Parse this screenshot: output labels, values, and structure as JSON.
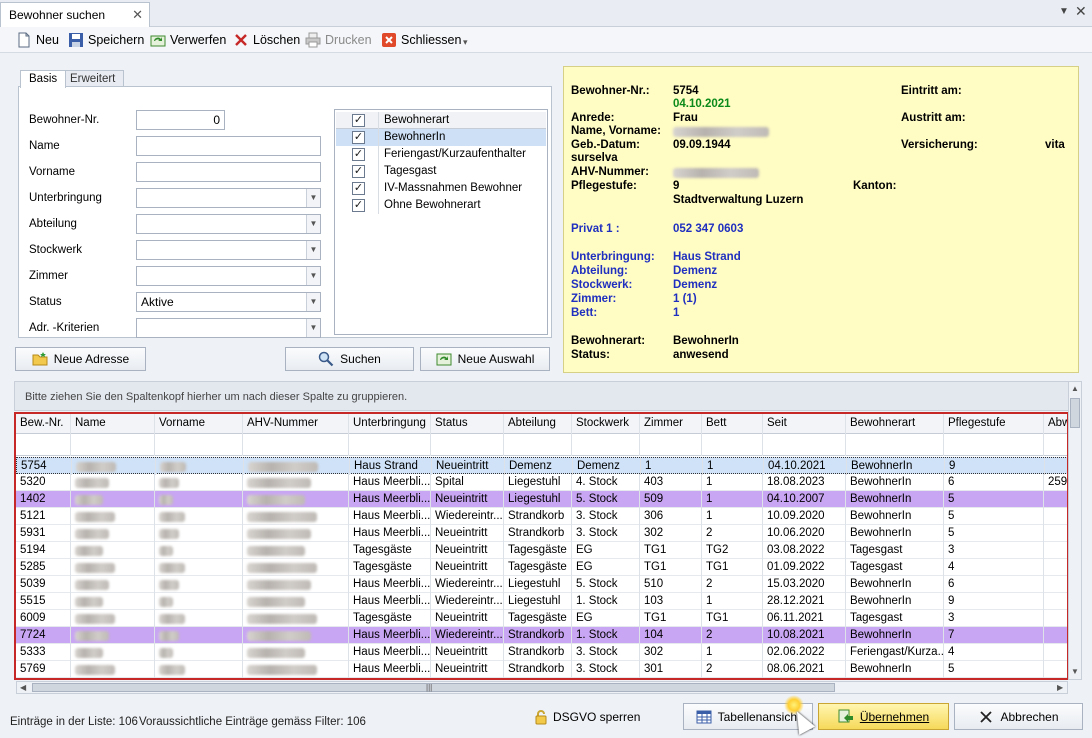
{
  "tab": {
    "title": "Bewohner suchen",
    "close": "✕"
  },
  "window": {
    "menu_arrow": "▼",
    "close": "✕"
  },
  "toolbar": {
    "neu": "Neu",
    "speichern": "Speichern",
    "verwerfen": "Verwerfen",
    "loeschen": "Löschen",
    "drucken": "Drucken",
    "schliessen": "Schliessen",
    "overflow": "▾"
  },
  "search": {
    "tabs": [
      "Basis",
      "Erweitert"
    ],
    "labels": {
      "bewohner_nr": "Bewohner-Nr.",
      "name": "Name",
      "vorname": "Vorname",
      "unterbringung": "Unterbringung",
      "abteilung": "Abteilung",
      "stockwerk": "Stockwerk",
      "zimmer": "Zimmer",
      "status": "Status",
      "adr": "Adr. -Kriterien"
    },
    "values": {
      "bewohner_nr": "0",
      "status": "Aktive"
    },
    "dropdown_arrow": "▼",
    "checklist": {
      "header": "Bewohnerart",
      "items": [
        "BewohnerIn",
        "Feriengast/Kurzaufenthalter",
        "Tagesgast",
        "IV-Massnahmen Bewohner",
        "Ohne Bewohnerart"
      ],
      "check": "✓"
    },
    "buttons": {
      "neue_adresse": "Neue Adresse",
      "suchen": "Suchen",
      "neue_auswahl": "Neue Auswahl"
    }
  },
  "info": {
    "bewohner_nr_label": "Bewohner-Nr.:",
    "bewohner_nr": "5754",
    "date": "04.10.2021",
    "eintritt_label": "Eintritt am:",
    "anrede_label": "Anrede:",
    "anrede": "Frau",
    "austritt_label": "Austritt am:",
    "name_label": "Name, Vorname:",
    "geb_label": "Geb.-Datum:",
    "geb": "09.09.1944",
    "versicherung_label": "Versicherung:",
    "versicherung": "vita",
    "surselva": "surselva",
    "ahv_label": "AHV-Nummer:",
    "pflegestufe_label": "Pflegestufe:",
    "pflegestufe": "9",
    "kanton_label": "Kanton:",
    "verwaltung": "Stadtverwaltung Luzern",
    "privat_label": "Privat 1 :",
    "privat": "052 347 0603",
    "unterbringung_label": "Unterbringung:",
    "unterbringung": "Haus Strand",
    "abteilung_label": "Abteilung:",
    "abteilung": "Demenz",
    "stockwerk_label": "Stockwerk:",
    "stockwerk": "Demenz",
    "zimmer_label": "Zimmer:",
    "zimmer": "1 (1)",
    "bett_label": "Bett:",
    "bett": "1",
    "bewohnerart_label": "Bewohnerart:",
    "bewohnerart": "BewohnerIn",
    "status_label": "Status:",
    "status": "anwesend"
  },
  "grid": {
    "group_hint": "Bitte ziehen Sie den Spaltenkopf hierher um nach dieser Spalte zu gruppieren.",
    "columns": [
      "Bew.-Nr.",
      "Name",
      "Vorname",
      "AHV-Nummer",
      "Unterbringung",
      "Status",
      "Abteilung",
      "Stockwerk",
      "Zimmer",
      "Bett",
      "Seit",
      "Bewohnerart",
      "Pflegestufe",
      "Abw"
    ],
    "rows": [
      {
        "nr": "5754",
        "unterbringung": "Haus Strand",
        "status": "Neueintritt",
        "abteilung": "Demenz",
        "stockwerk": "Demenz",
        "zimmer": "1",
        "bett": "1",
        "seit": "04.10.2021",
        "bewohnerart": "BewohnerIn",
        "pflegestufe": "9",
        "abw": "",
        "style": "selected"
      },
      {
        "nr": "5320",
        "unterbringung": "Haus Meerbli...",
        "status": "Spital",
        "abteilung": "Liegestuhl",
        "stockwerk": "4. Stock",
        "zimmer": "403",
        "bett": "1",
        "seit": "18.08.2023",
        "bewohnerart": "BewohnerIn",
        "pflegestufe": "6",
        "abw": "259",
        "style": ""
      },
      {
        "nr": "1402",
        "unterbringung": "Haus Meerbli...",
        "status": "Neueintritt",
        "abteilung": "Liegestuhl",
        "stockwerk": "5. Stock",
        "zimmer": "509",
        "bett": "1",
        "seit": "04.10.2007",
        "bewohnerart": "BewohnerIn",
        "pflegestufe": "5",
        "abw": "",
        "style": "purple"
      },
      {
        "nr": "5121",
        "unterbringung": "Haus Meerbli...",
        "status": "Wiedereintr...",
        "abteilung": "Strandkorb",
        "stockwerk": "3. Stock",
        "zimmer": "306",
        "bett": "1",
        "seit": "10.09.2020",
        "bewohnerart": "BewohnerIn",
        "pflegestufe": "5",
        "abw": "",
        "style": ""
      },
      {
        "nr": "5931",
        "unterbringung": "Haus Meerbli...",
        "status": "Neueintritt",
        "abteilung": "Strandkorb",
        "stockwerk": "3. Stock",
        "zimmer": "302",
        "bett": "2",
        "seit": "10.06.2020",
        "bewohnerart": "BewohnerIn",
        "pflegestufe": "5",
        "abw": "",
        "style": ""
      },
      {
        "nr": "5194",
        "unterbringung": "Tagesgäste",
        "status": "Neueintritt",
        "abteilung": "Tagesgäste",
        "stockwerk": "EG",
        "zimmer": "TG1",
        "bett": "TG2",
        "seit": "03.08.2022",
        "bewohnerart": "Tagesgast",
        "pflegestufe": "3",
        "abw": "",
        "style": ""
      },
      {
        "nr": "5285",
        "unterbringung": "Tagesgäste",
        "status": "Neueintritt",
        "abteilung": "Tagesgäste",
        "stockwerk": "EG",
        "zimmer": "TG1",
        "bett": "TG1",
        "seit": "01.09.2022",
        "bewohnerart": "Tagesgast",
        "pflegestufe": "4",
        "abw": "",
        "style": ""
      },
      {
        "nr": "5039",
        "unterbringung": "Haus Meerbli...",
        "status": "Wiedereintr...",
        "abteilung": "Liegestuhl",
        "stockwerk": "5. Stock",
        "zimmer": "510",
        "bett": "2",
        "seit": "15.03.2020",
        "bewohnerart": "BewohnerIn",
        "pflegestufe": "6",
        "abw": "",
        "style": ""
      },
      {
        "nr": "5515",
        "unterbringung": "Haus Meerbli...",
        "status": "Wiedereintr...",
        "abteilung": "Liegestuhl",
        "stockwerk": "1. Stock",
        "zimmer": "103",
        "bett": "1",
        "seit": "28.12.2021",
        "bewohnerart": "BewohnerIn",
        "pflegestufe": "9",
        "abw": "",
        "style": ""
      },
      {
        "nr": "6009",
        "unterbringung": "Tagesgäste",
        "status": "Neueintritt",
        "abteilung": "Tagesgäste",
        "stockwerk": "EG",
        "zimmer": "TG1",
        "bett": "TG1",
        "seit": "06.11.2021",
        "bewohnerart": "Tagesgast",
        "pflegestufe": "3",
        "abw": "",
        "style": ""
      },
      {
        "nr": "7724",
        "unterbringung": "Haus Meerbli...",
        "status": "Wiedereintr...",
        "abteilung": "Strandkorb",
        "stockwerk": "1. Stock",
        "zimmer": "104",
        "bett": "2",
        "seit": "10.08.2021",
        "bewohnerart": "BewohnerIn",
        "pflegestufe": "7",
        "abw": "",
        "style": "purple"
      },
      {
        "nr": "5333",
        "unterbringung": "Haus Meerbli...",
        "status": "Neueintritt",
        "abteilung": "Strandkorb",
        "stockwerk": "3. Stock",
        "zimmer": "302",
        "bett": "1",
        "seit": "02.06.2022",
        "bewohnerart": "Feriengast/Kurza...",
        "pflegestufe": "4",
        "abw": "",
        "style": ""
      },
      {
        "nr": "5769",
        "unterbringung": "Haus Meerbli...",
        "status": "Neueintritt",
        "abteilung": "Strandkorb",
        "stockwerk": "3. Stock",
        "zimmer": "301",
        "bett": "2",
        "seit": "08.06.2021",
        "bewohnerart": "BewohnerIn",
        "pflegestufe": "5",
        "abw": "",
        "style": ""
      }
    ]
  },
  "scroll_arrows": {
    "up": "▲",
    "down": "▼",
    "left": "◀",
    "right": "▶",
    "grip": "|||"
  },
  "footer": {
    "count": "Einträge in der Liste: 106",
    "expected": "Voraussichtliche Einträge gemäss Filter: 106",
    "dsgvo": "DSGVO sperren",
    "tabellenansicht": "Tabellenansicht",
    "uebernehmen": "Übernehmen",
    "abbrechen": "Abbrechen"
  },
  "colors": {
    "highlight_purple": "#c9a6f3",
    "info_bg": "#fffcc4",
    "grid_border": "#c62828",
    "selected_row": "#cfe2f7"
  }
}
